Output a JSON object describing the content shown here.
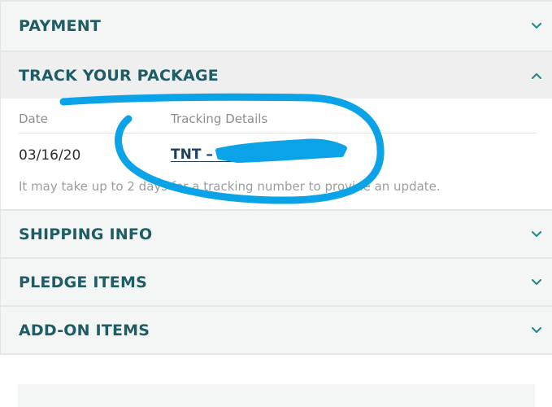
{
  "sections": [
    {
      "title": "PAYMENT",
      "state": "collapsed"
    },
    {
      "title": "TRACK YOUR PACKAGE",
      "state": "expanded"
    },
    {
      "title": "SHIPPING INFO",
      "state": "collapsed"
    },
    {
      "title": "PLEDGE ITEMS",
      "state": "collapsed"
    },
    {
      "title": "ADD-ON ITEMS",
      "state": "collapsed"
    }
  ],
  "tracking": {
    "date_header": "Date",
    "details_header": "Tracking Details",
    "row": {
      "date": "03/16/20",
      "carrier_link": "TNT – AM"
    },
    "note": "It may take up to 2 days for a tracking number to provide an update."
  },
  "icons": {
    "collapsed": "chevron-down-icon",
    "expanded": "chevron-up-icon"
  },
  "colors": {
    "header_text": "#1f5c63",
    "chevron": "#2f8a8a",
    "scribble": "#0aa3e8",
    "link": "#1f3f60"
  }
}
